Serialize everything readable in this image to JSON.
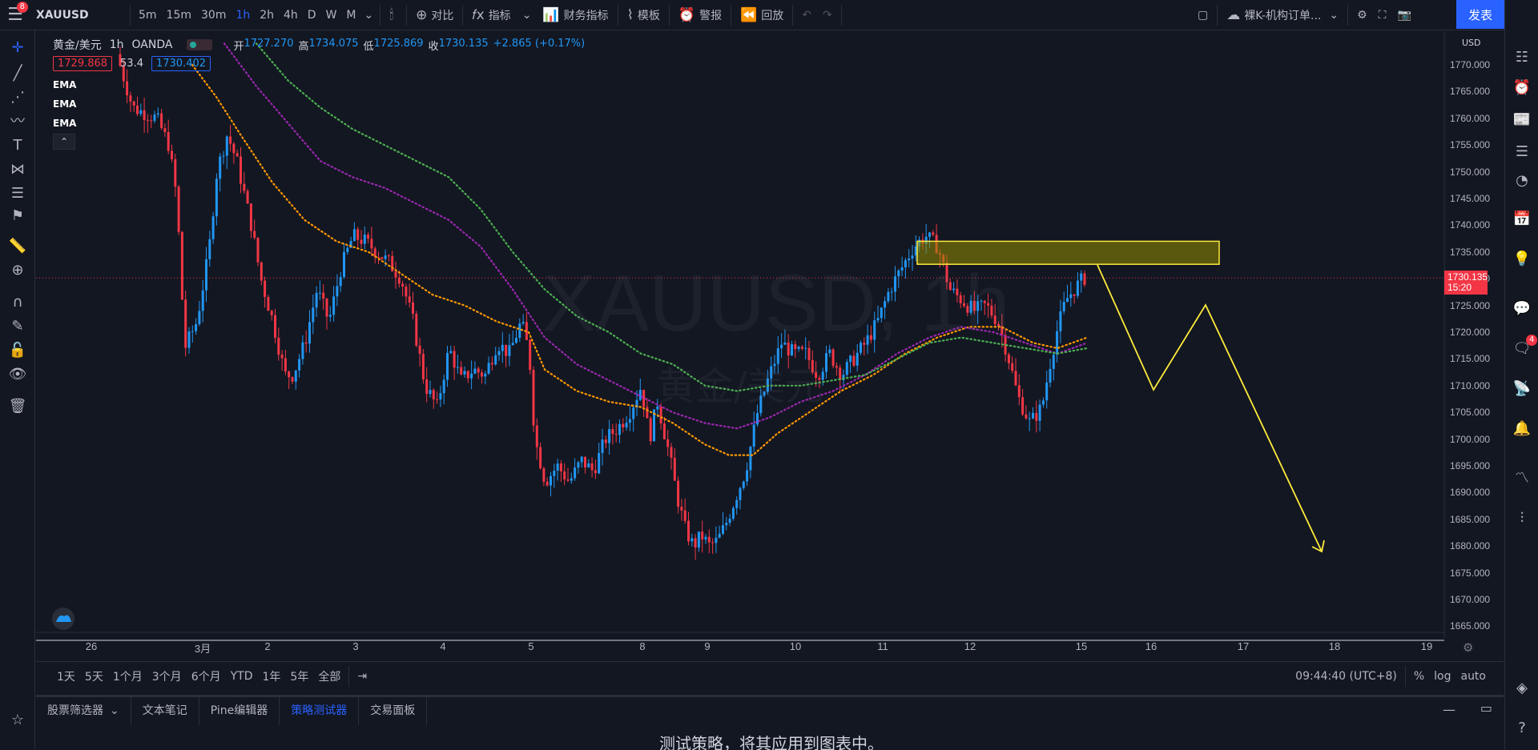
{
  "topbar": {
    "menu_badge": "8",
    "symbol": "XAUUSD",
    "intervals": [
      "5m",
      "15m",
      "30m",
      "1h",
      "2h",
      "4h",
      "D",
      "W",
      "M"
    ],
    "active_interval": "1h",
    "compare": "对比",
    "indicators": "指标",
    "financials": "财务指标",
    "templates": "模板",
    "alerts": "警报",
    "replay": "回放",
    "layout_name": "裸K-机构订单...",
    "publish": "发表"
  },
  "legend": {
    "title": "黄金/美元",
    "interval": "1h",
    "source": "OANDA",
    "open_label": "开",
    "open": "1727.270",
    "high_label": "高",
    "high": "1734.075",
    "low_label": "低",
    "low": "1725.869",
    "close_label": "收",
    "close": "1730.135",
    "change": "+2.865 (+0.17%)",
    "sell": "1729.868",
    "spread": "53.4",
    "buy": "1730.402",
    "indicators": [
      "EMA",
      "EMA",
      "EMA"
    ]
  },
  "watermark": {
    "main": "XAUUSD, 1h",
    "sub": "黄金/美元"
  },
  "price_scale": {
    "currency": "USD",
    "ticks": [
      "1770.000",
      "1765.000",
      "1760.000",
      "1755.000",
      "1750.000",
      "1745.000",
      "1740.000",
      "1735.000",
      "1730.000",
      "1725.000",
      "1720.000",
      "1715.000",
      "1710.000",
      "1705.000",
      "1700.000",
      "1695.000",
      "1690.000",
      "1685.000",
      "1680.000",
      "1675.000",
      "1670.000",
      "1665.000"
    ],
    "current_price": "1730.135",
    "countdown": "15:20"
  },
  "time_scale": {
    "labels": [
      "26",
      "3月",
      "2",
      "3",
      "4",
      "5",
      "8",
      "9",
      "10",
      "11",
      "12",
      "15",
      "16",
      "17",
      "18",
      "19"
    ]
  },
  "rangebar": {
    "ranges": [
      "1天",
      "5天",
      "1个月",
      "3个月",
      "6个月",
      "YTD",
      "1年",
      "5年",
      "全部"
    ],
    "clock": "09:44:40 (UTC+8)",
    "percent": "%",
    "log": "log",
    "auto": "auto"
  },
  "bottom_panel": {
    "tabs": [
      "股票筛选器",
      "文本笔记",
      "Pine编辑器",
      "策略测试器",
      "交易面板"
    ],
    "active_tab": "策略测试器",
    "message": "测试策略，将其应用到图表中。"
  },
  "colors": {
    "background": "#131722",
    "up_candle": "#2196f3",
    "down_candle": "#f23645",
    "ema_fast": "#ff9800",
    "ema_mid": "#9c27b0",
    "ema_slow": "#4caf50",
    "drawing": "#ffeb3b",
    "accent": "#2962ff"
  }
}
